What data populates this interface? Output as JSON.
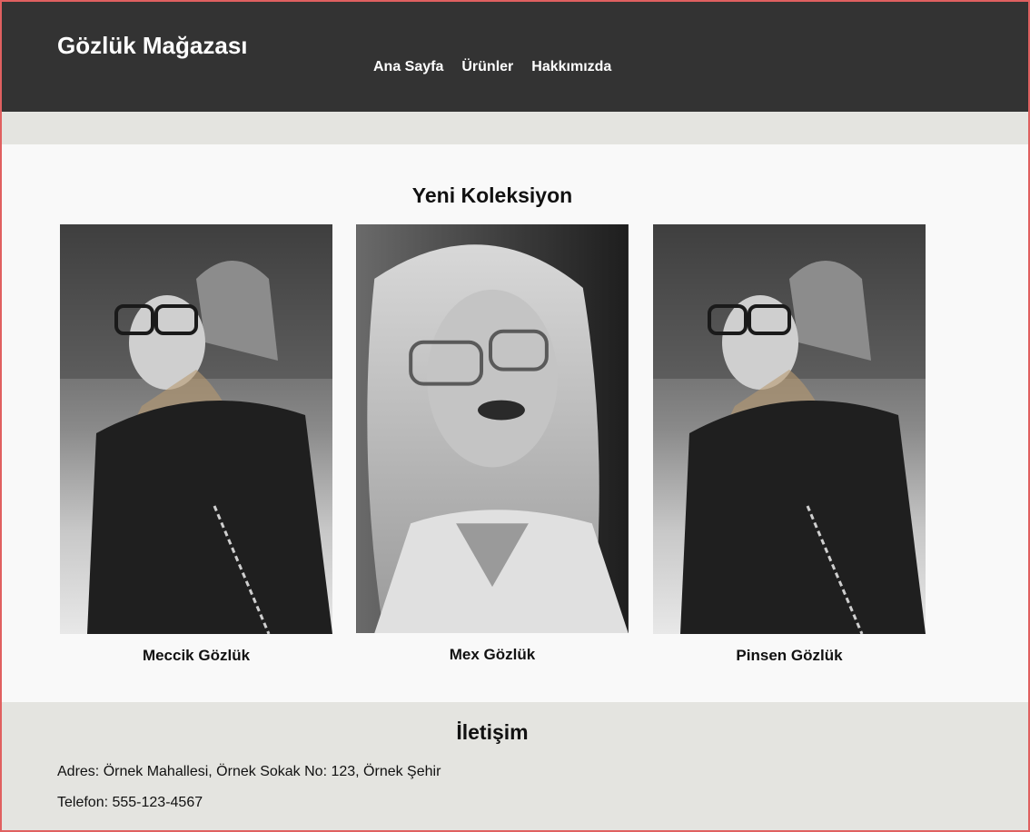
{
  "header": {
    "brand": "Gözlük Mağazası",
    "nav": [
      "Ana Sayfa",
      "Ürünler",
      "Hakkımızda"
    ]
  },
  "collection": {
    "title": "Yeni Koleksiyon",
    "products": [
      {
        "name": "Meccik Gözlük",
        "image": "woman-beanie-glasses-photo"
      },
      {
        "name": "Mex Gözlük",
        "image": "blonde-woman-glasses-photo"
      },
      {
        "name": "Pinsen Gözlük",
        "image": "woman-beanie-glasses-photo"
      }
    ]
  },
  "contact": {
    "title": "İletişim",
    "address": "Adres: Örnek Mahallesi, Örnek Sokak No: 123, Örnek Şehir",
    "phone": "Telefon: 555-123-4567"
  },
  "colors": {
    "header_bg": "#333333",
    "band_bg": "#e4e4e0",
    "main_bg": "#f9f9f9",
    "frame_border": "#e06060"
  }
}
